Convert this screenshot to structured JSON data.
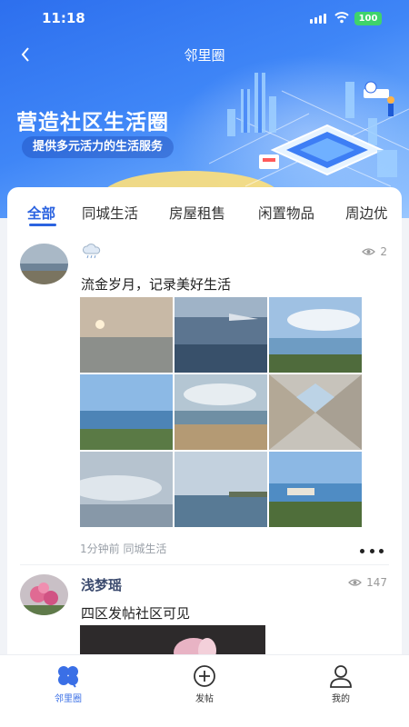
{
  "status_bar": {
    "time": "11:18",
    "battery": "100"
  },
  "header": {
    "title": "邻里圈"
  },
  "banner": {
    "title": "营造社区生活圈",
    "subtitle": "提供多元活力的生活服务"
  },
  "tabs": [
    {
      "label": "全部",
      "active": true
    },
    {
      "label": "同城生活",
      "active": false
    },
    {
      "label": "房屋租售",
      "active": false
    },
    {
      "label": "闲置物品",
      "active": false
    },
    {
      "label": "周边优",
      "active": false
    }
  ],
  "posts": [
    {
      "author": "",
      "weather_icon": "rain-cloud-icon",
      "views": "2",
      "text": "流金岁月，记录美好生活",
      "time": "1分钟前",
      "category": "同城生活",
      "photo_count": 9
    },
    {
      "author": "浅梦瑶",
      "views": "147",
      "text": "四区发帖社区可见"
    }
  ],
  "bottom_nav": [
    {
      "label": "邻里圈",
      "icon": "clover-icon",
      "active": true
    },
    {
      "label": "发帖",
      "icon": "plus-circle-icon",
      "active": false
    },
    {
      "label": "我的",
      "icon": "user-icon",
      "active": false
    }
  ],
  "colors": {
    "accent": "#2b63e0",
    "banner": "#3f86f7",
    "battery": "#3fd36b"
  }
}
